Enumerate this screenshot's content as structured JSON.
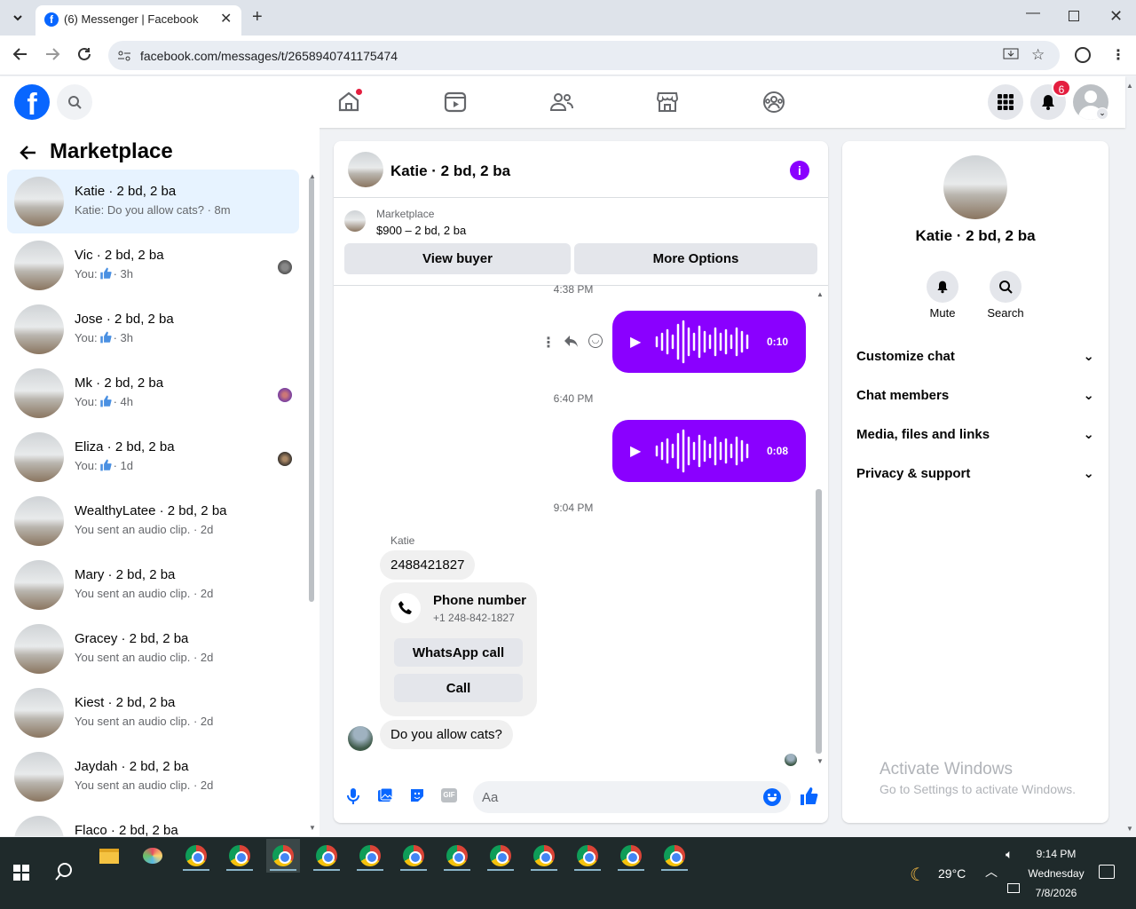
{
  "browser": {
    "tab_title": "(6) Messenger | Facebook",
    "url": "facebook.com/messages/t/2658940741175474"
  },
  "header": {
    "notification_count": "6"
  },
  "sidebar": {
    "title": "Marketplace",
    "conversations": [
      {
        "name": "Katie · 2 bd, 2 ba",
        "preview": "Katie: Do you allow cats? · 8m",
        "selected": true
      },
      {
        "name": "Vic · 2 bd, 2 ba",
        "preview_prefix": "You:",
        "preview_time": "· 3h",
        "has_like": true
      },
      {
        "name": "Jose · 2 bd, 2 ba",
        "preview_prefix": "You:",
        "preview_time": "· 3h",
        "has_like": true
      },
      {
        "name": "Mk · 2 bd, 2 ba",
        "preview_prefix": "You:",
        "preview_time": "· 4h",
        "has_like": true
      },
      {
        "name": "Eliza · 2 bd, 2 ba",
        "preview_prefix": "You:",
        "preview_time": "· 1d",
        "has_like": true
      },
      {
        "name": "WealthyLatee · 2 bd, 2 ba",
        "preview": "You sent an audio clip. · 2d"
      },
      {
        "name": "Mary · 2 bd, 2 ba",
        "preview": "You sent an audio clip. · 2d"
      },
      {
        "name": "Gracey · 2 bd, 2 ba",
        "preview": "You sent an audio clip. · 2d"
      },
      {
        "name": "Kiest · 2 bd, 2 ba",
        "preview": "You sent an audio clip. · 2d"
      },
      {
        "name": "Jaydah · 2 bd, 2 ba",
        "preview": "You sent an audio clip. · 2d"
      },
      {
        "name": "Flaco · 2 bd, 2 ba",
        "preview": ""
      }
    ]
  },
  "chat": {
    "title": "Katie · 2 bd, 2 ba",
    "listing_source": "Marketplace",
    "listing_title": "$900 – 2 bd, 2 ba",
    "view_buyer_label": "View buyer",
    "more_options_label": "More Options",
    "ts1": "4:38 PM",
    "audio1_duration": "0:10",
    "ts2": "6:40 PM",
    "audio2_duration": "0:08",
    "ts3": "9:04 PM",
    "sender_name": "Katie",
    "msg_phone": "2488421827",
    "phone_card_title": "Phone number",
    "phone_card_number": "+1 248-842-1827",
    "whatsapp_label": "WhatsApp call",
    "call_label": "Call",
    "msg_cats": "Do you allow cats?",
    "composer_placeholder": "Aa"
  },
  "details": {
    "name": "Katie · 2 bd, 2 ba",
    "mute_label": "Mute",
    "search_label": "Search",
    "sections": [
      "Customize chat",
      "Chat members",
      "Media, files and links",
      "Privacy & support"
    ]
  },
  "watermark": {
    "line1": "Activate Windows",
    "line2": "Go to Settings to activate Windows."
  },
  "taskbar": {
    "weather": "29°C",
    "time": "9:14 PM",
    "day": "Wednesday",
    "date": "7/8/2026"
  },
  "colors": {
    "accent_purple": "#8a00ff",
    "fb_blue": "#0866ff",
    "selected_bg": "#e7f3ff"
  }
}
